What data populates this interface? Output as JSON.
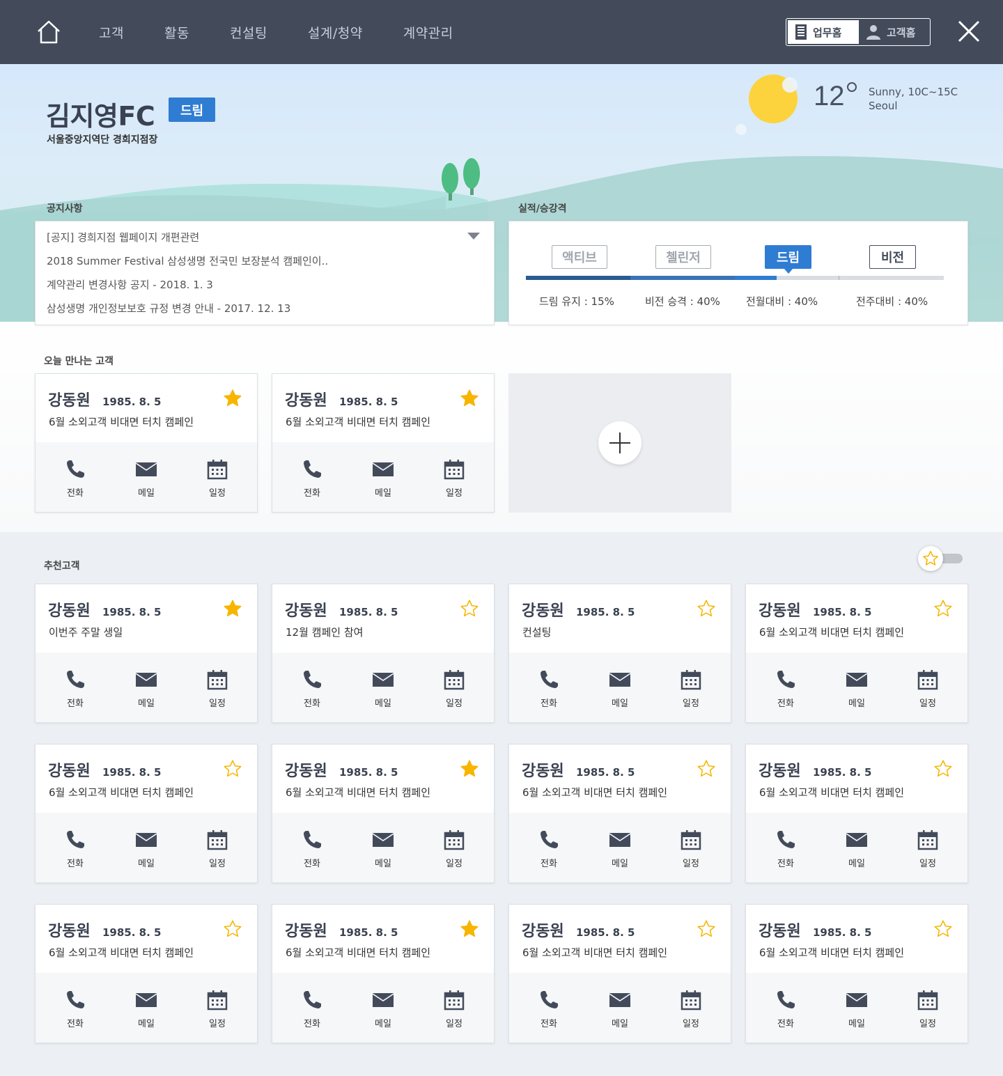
{
  "nav": {
    "home_icon": "home-icon",
    "items": [
      "고객",
      "활동",
      "컨설팅",
      "설계/청약",
      "계약관리"
    ],
    "mode_active": "업무홈",
    "mode_inactive": "고객홈",
    "close_icon": "close-icon"
  },
  "profile": {
    "name": "김지영FC",
    "grade_badge": "드림",
    "branch": "서울중앙지역단 경희지점장"
  },
  "weather": {
    "temperature": "12",
    "condition": "Sunny, 10C~15C",
    "city": "Seoul",
    "icon": "sunny-icon"
  },
  "notice": {
    "title": "공지사항",
    "items": [
      "[공지] 경희지점 웹페이지 개편관련",
      "2018 Summer Festival 삼성생명 전국민 보장분석 캠페인이..",
      "계약관리 변경사항 공지 - 2018. 1. 3",
      "삼성생명 개인정보보호 규정 변경 안내 - 2017. 12. 13"
    ]
  },
  "performance": {
    "title": "실적/승강격",
    "grades": [
      "액티브",
      "첼린저",
      "드림",
      "비전"
    ],
    "current_grade": "드림",
    "progress_fraction": 0.6,
    "stats": [
      "드림 유지 : 15%",
      "비전 승격 : 40%",
      "전월대비 : 40%",
      "전주대비 : 40%"
    ],
    "colors": {
      "dark": "#2a5c93",
      "mid": "#3a73b5",
      "accent": "#2f7cd3",
      "track": "#d9dce0"
    }
  },
  "today": {
    "title": "오늘 만나는 고객",
    "add_icon": "plus-icon",
    "cards": [
      {
        "name": "강동원",
        "date": "1985. 8. 5",
        "desc": "6월 소외고객 비대면 터치 캠페인",
        "starred": true
      },
      {
        "name": "강동원",
        "date": "1985. 8. 5",
        "desc": "6월 소외고객 비대면 터치 캠페인",
        "starred": true
      }
    ]
  },
  "recommended": {
    "title": "추천고객",
    "favorite_filter_on": false,
    "cards": [
      {
        "name": "강동원",
        "date": "1985. 8. 5",
        "desc": "이번주 주말 생일",
        "starred": true
      },
      {
        "name": "강동원",
        "date": "1985. 8. 5",
        "desc": "12월 캠페인 참여",
        "starred": false
      },
      {
        "name": "강동원",
        "date": "1985. 8. 5",
        "desc": "컨설팅",
        "starred": false
      },
      {
        "name": "강동원",
        "date": "1985. 8. 5",
        "desc": "6월 소외고객 비대면 터치 캠페인",
        "starred": false
      },
      {
        "name": "강동원",
        "date": "1985. 8. 5",
        "desc": "6월 소외고객 비대면 터치 캠페인",
        "starred": false
      },
      {
        "name": "강동원",
        "date": "1985. 8. 5",
        "desc": "6월 소외고객 비대면 터치 캠페인",
        "starred": true
      },
      {
        "name": "강동원",
        "date": "1985. 8. 5",
        "desc": "6월 소외고객 비대면 터치 캠페인",
        "starred": false
      },
      {
        "name": "강동원",
        "date": "1985. 8. 5",
        "desc": "6월 소외고객 비대면 터치 캠페인",
        "starred": false
      },
      {
        "name": "강동원",
        "date": "1985. 8. 5",
        "desc": "6월 소외고객 비대면 터치 캠페인",
        "starred": false
      },
      {
        "name": "강동원",
        "date": "1985. 8. 5",
        "desc": "6월 소외고객 비대면 터치 캠페인",
        "starred": true
      },
      {
        "name": "강동원",
        "date": "1985. 8. 5",
        "desc": "6월 소외고객 비대면 터치 캠페인",
        "starred": false
      },
      {
        "name": "강동원",
        "date": "1985. 8. 5",
        "desc": "6월 소외고객 비대면 터치 캠페인",
        "starred": false
      }
    ]
  },
  "card_actions": {
    "call": "전화",
    "mail": "메일",
    "schedule": "일정",
    "icons": [
      "phone-icon",
      "mail-icon",
      "calendar-icon"
    ]
  },
  "colors": {
    "topbar": "#434b5b",
    "accent_blue": "#2f7cd3",
    "star_gold": "#f7b500"
  }
}
